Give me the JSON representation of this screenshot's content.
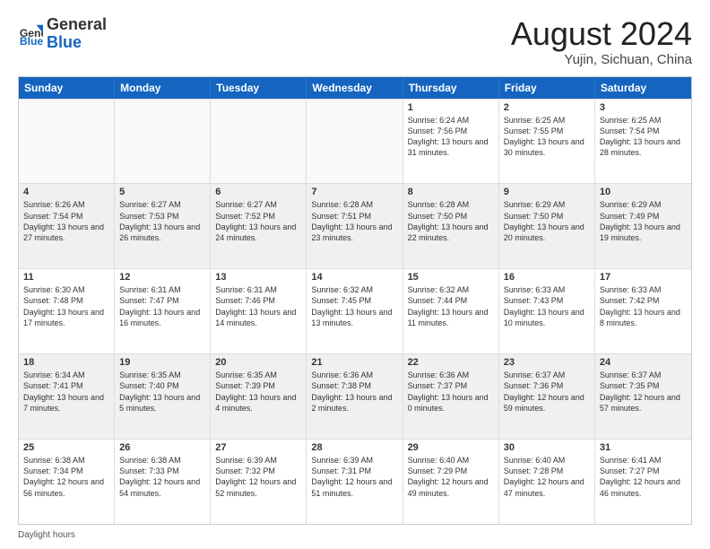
{
  "header": {
    "logo_general": "General",
    "logo_blue": "Blue",
    "month_title": "August 2024",
    "subtitle": "Yujin, Sichuan, China"
  },
  "calendar": {
    "days_of_week": [
      "Sunday",
      "Monday",
      "Tuesday",
      "Wednesday",
      "Thursday",
      "Friday",
      "Saturday"
    ],
    "rows": [
      [
        {
          "num": "",
          "text": "",
          "empty": true
        },
        {
          "num": "",
          "text": "",
          "empty": true
        },
        {
          "num": "",
          "text": "",
          "empty": true
        },
        {
          "num": "",
          "text": "",
          "empty": true
        },
        {
          "num": "1",
          "text": "Sunrise: 6:24 AM\nSunset: 7:56 PM\nDaylight: 13 hours and 31 minutes."
        },
        {
          "num": "2",
          "text": "Sunrise: 6:25 AM\nSunset: 7:55 PM\nDaylight: 13 hours and 30 minutes."
        },
        {
          "num": "3",
          "text": "Sunrise: 6:25 AM\nSunset: 7:54 PM\nDaylight: 13 hours and 28 minutes."
        }
      ],
      [
        {
          "num": "4",
          "text": "Sunrise: 6:26 AM\nSunset: 7:54 PM\nDaylight: 13 hours and 27 minutes.",
          "shaded": true
        },
        {
          "num": "5",
          "text": "Sunrise: 6:27 AM\nSunset: 7:53 PM\nDaylight: 13 hours and 26 minutes.",
          "shaded": true
        },
        {
          "num": "6",
          "text": "Sunrise: 6:27 AM\nSunset: 7:52 PM\nDaylight: 13 hours and 24 minutes.",
          "shaded": true
        },
        {
          "num": "7",
          "text": "Sunrise: 6:28 AM\nSunset: 7:51 PM\nDaylight: 13 hours and 23 minutes.",
          "shaded": true
        },
        {
          "num": "8",
          "text": "Sunrise: 6:28 AM\nSunset: 7:50 PM\nDaylight: 13 hours and 22 minutes.",
          "shaded": true
        },
        {
          "num": "9",
          "text": "Sunrise: 6:29 AM\nSunset: 7:50 PM\nDaylight: 13 hours and 20 minutes.",
          "shaded": true
        },
        {
          "num": "10",
          "text": "Sunrise: 6:29 AM\nSunset: 7:49 PM\nDaylight: 13 hours and 19 minutes.",
          "shaded": true
        }
      ],
      [
        {
          "num": "11",
          "text": "Sunrise: 6:30 AM\nSunset: 7:48 PM\nDaylight: 13 hours and 17 minutes."
        },
        {
          "num": "12",
          "text": "Sunrise: 6:31 AM\nSunset: 7:47 PM\nDaylight: 13 hours and 16 minutes."
        },
        {
          "num": "13",
          "text": "Sunrise: 6:31 AM\nSunset: 7:46 PM\nDaylight: 13 hours and 14 minutes."
        },
        {
          "num": "14",
          "text": "Sunrise: 6:32 AM\nSunset: 7:45 PM\nDaylight: 13 hours and 13 minutes."
        },
        {
          "num": "15",
          "text": "Sunrise: 6:32 AM\nSunset: 7:44 PM\nDaylight: 13 hours and 11 minutes."
        },
        {
          "num": "16",
          "text": "Sunrise: 6:33 AM\nSunset: 7:43 PM\nDaylight: 13 hours and 10 minutes."
        },
        {
          "num": "17",
          "text": "Sunrise: 6:33 AM\nSunset: 7:42 PM\nDaylight: 13 hours and 8 minutes."
        }
      ],
      [
        {
          "num": "18",
          "text": "Sunrise: 6:34 AM\nSunset: 7:41 PM\nDaylight: 13 hours and 7 minutes.",
          "shaded": true
        },
        {
          "num": "19",
          "text": "Sunrise: 6:35 AM\nSunset: 7:40 PM\nDaylight: 13 hours and 5 minutes.",
          "shaded": true
        },
        {
          "num": "20",
          "text": "Sunrise: 6:35 AM\nSunset: 7:39 PM\nDaylight: 13 hours and 4 minutes.",
          "shaded": true
        },
        {
          "num": "21",
          "text": "Sunrise: 6:36 AM\nSunset: 7:38 PM\nDaylight: 13 hours and 2 minutes.",
          "shaded": true
        },
        {
          "num": "22",
          "text": "Sunrise: 6:36 AM\nSunset: 7:37 PM\nDaylight: 13 hours and 0 minutes.",
          "shaded": true
        },
        {
          "num": "23",
          "text": "Sunrise: 6:37 AM\nSunset: 7:36 PM\nDaylight: 12 hours and 59 minutes.",
          "shaded": true
        },
        {
          "num": "24",
          "text": "Sunrise: 6:37 AM\nSunset: 7:35 PM\nDaylight: 12 hours and 57 minutes.",
          "shaded": true
        }
      ],
      [
        {
          "num": "25",
          "text": "Sunrise: 6:38 AM\nSunset: 7:34 PM\nDaylight: 12 hours and 56 minutes."
        },
        {
          "num": "26",
          "text": "Sunrise: 6:38 AM\nSunset: 7:33 PM\nDaylight: 12 hours and 54 minutes."
        },
        {
          "num": "27",
          "text": "Sunrise: 6:39 AM\nSunset: 7:32 PM\nDaylight: 12 hours and 52 minutes."
        },
        {
          "num": "28",
          "text": "Sunrise: 6:39 AM\nSunset: 7:31 PM\nDaylight: 12 hours and 51 minutes."
        },
        {
          "num": "29",
          "text": "Sunrise: 6:40 AM\nSunset: 7:29 PM\nDaylight: 12 hours and 49 minutes."
        },
        {
          "num": "30",
          "text": "Sunrise: 6:40 AM\nSunset: 7:28 PM\nDaylight: 12 hours and 47 minutes."
        },
        {
          "num": "31",
          "text": "Sunrise: 6:41 AM\nSunset: 7:27 PM\nDaylight: 12 hours and 46 minutes."
        }
      ]
    ]
  },
  "footer": {
    "daylight_label": "Daylight hours"
  }
}
